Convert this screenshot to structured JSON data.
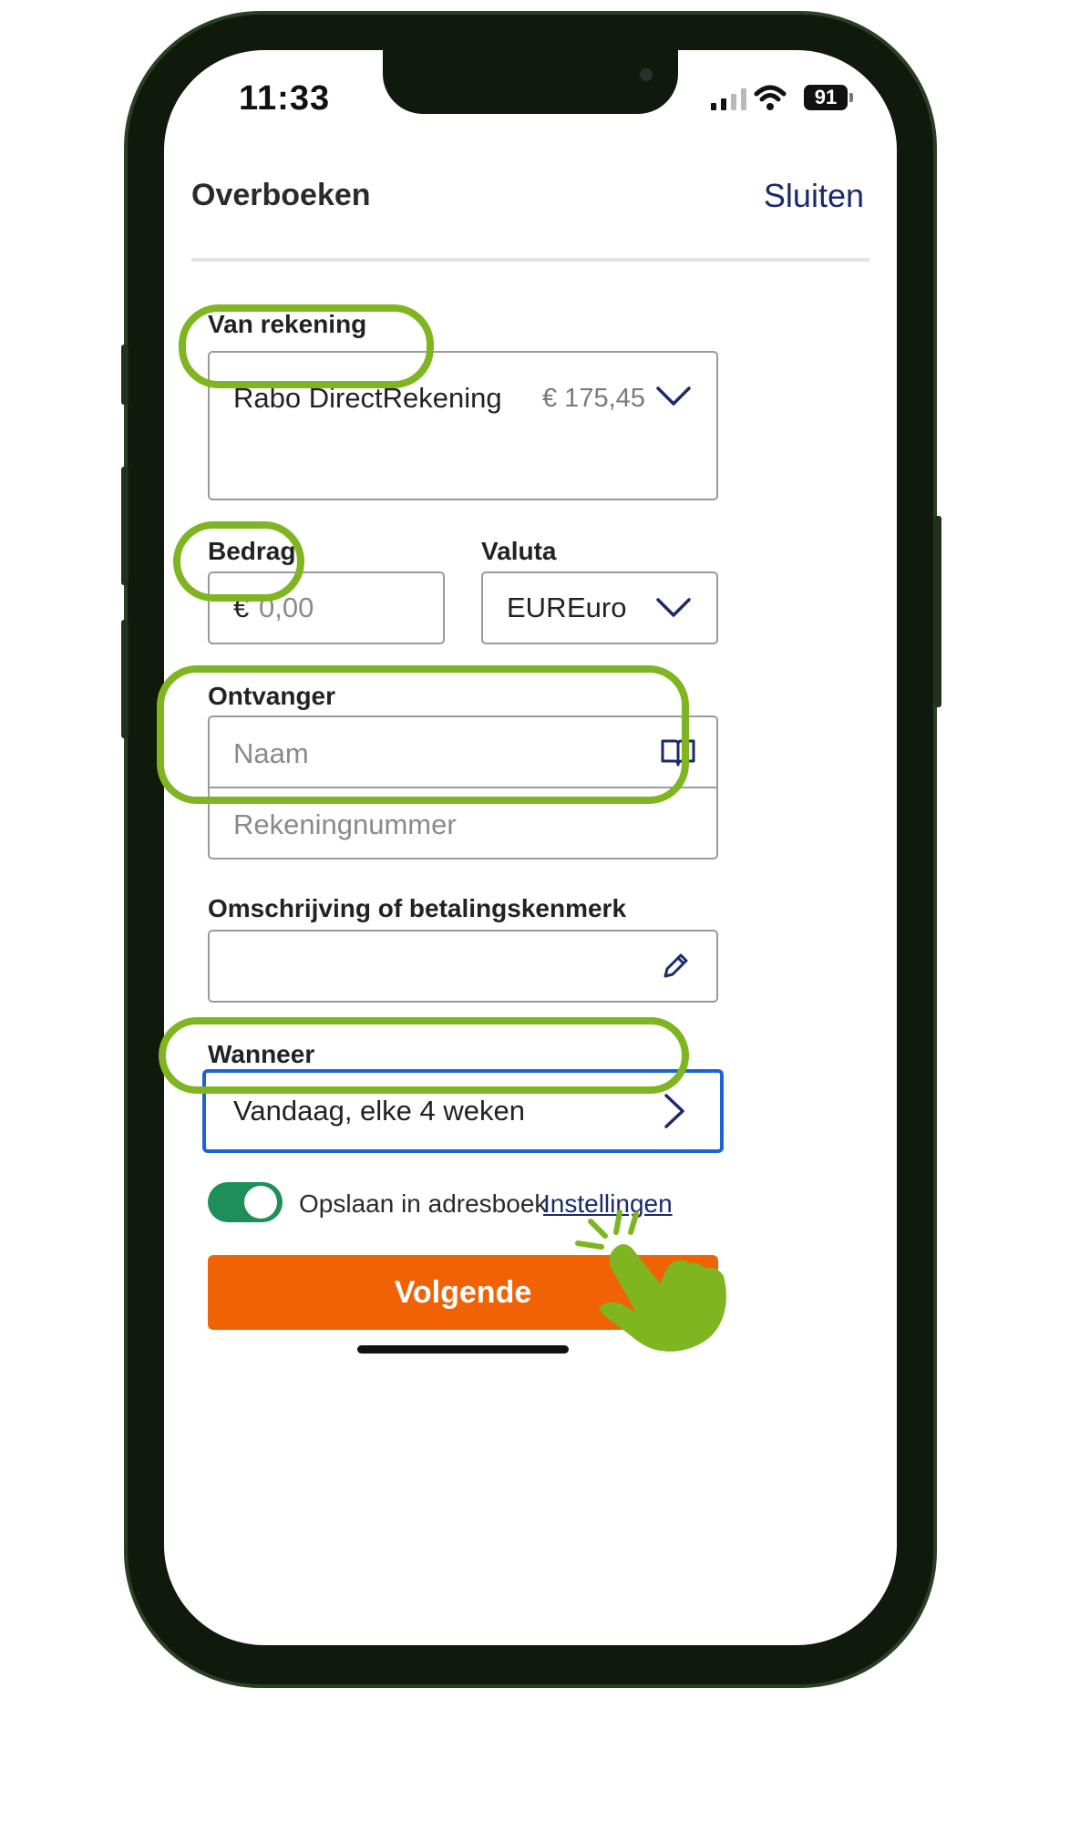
{
  "status_bar": {
    "time": "11:33",
    "battery": "91"
  },
  "header": {
    "title": "Overboeken",
    "close_label": "Sluiten"
  },
  "from_account": {
    "label": "Van rekening",
    "account_name": "Rabo DirectRekening",
    "balance": "€ 175,45"
  },
  "amount": {
    "label": "Bedrag",
    "currency_symbol": "€",
    "placeholder": "0,00"
  },
  "currency": {
    "label": "Valuta",
    "code": "EUR",
    "name": "Euro"
  },
  "recipient": {
    "label": "Ontvanger",
    "name_placeholder": "Naam",
    "account_placeholder": "Rekeningnummer"
  },
  "description": {
    "label": "Omschrijving of betalingskenmerk"
  },
  "when": {
    "label": "Wanneer",
    "value": "Vandaag, elke 4 weken"
  },
  "save": {
    "label": "Opslaan in adresboek",
    "settings_link": "Instellingen",
    "enabled": true
  },
  "next_button": {
    "label": "Volgende"
  },
  "colors": {
    "accent_orange": "#f16204",
    "toggle_green": "#1e8f58",
    "navy": "#1b2a6b",
    "highlight_green": "#7fb520",
    "focus_blue": "#1d63d6"
  }
}
